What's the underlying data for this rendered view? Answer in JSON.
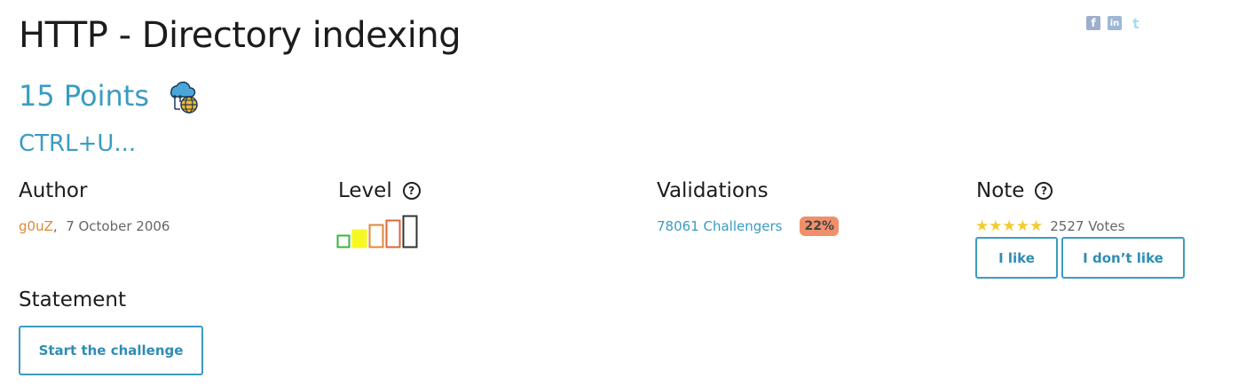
{
  "challenge": {
    "title": "HTTP - Directory indexing",
    "points": "15 Points",
    "category_icon": "cloud-network-globe-icon",
    "subtitle": "CTRL+U..."
  },
  "share": [
    {
      "name": "facebook-icon",
      "glyph": "f",
      "color": "#9eaecd"
    },
    {
      "name": "linkedin-icon",
      "glyph": "in",
      "color": "#9db8d4"
    },
    {
      "name": "twitter-icon",
      "glyph": "t",
      "color": "#a7dcf0"
    }
  ],
  "author": {
    "heading": "Author",
    "name": "g0uZ",
    "separator": ",",
    "date": "7 October 2006"
  },
  "level": {
    "heading": "Level",
    "help_icon": "question-circle-icon",
    "help_glyph": "?",
    "bars": [
      {
        "color": "#3bb53b",
        "filled": false
      },
      {
        "color": "#f7f722",
        "filled": true
      },
      {
        "color": "#e08a3a",
        "filled": false
      },
      {
        "color": "#e0653a",
        "filled": false
      },
      {
        "color": "#333333",
        "filled": false
      }
    ],
    "current_level": 2,
    "max_level": 5
  },
  "validations": {
    "heading": "Validations",
    "challengers": "78061 Challengers",
    "percent": "22%"
  },
  "note": {
    "heading": "Note",
    "help_glyph": "?",
    "rating": 5,
    "star_glyph": "★",
    "votes": "2527 Votes",
    "like_label": "I like",
    "dislike_label": "I don’t like"
  },
  "statement": {
    "heading": "Statement",
    "start_label": "Start the challenge"
  },
  "colors": {
    "accent": "#3a9cc2",
    "author": "#d98a3a",
    "badge": "#f0906a",
    "star": "#f2cc2e"
  }
}
